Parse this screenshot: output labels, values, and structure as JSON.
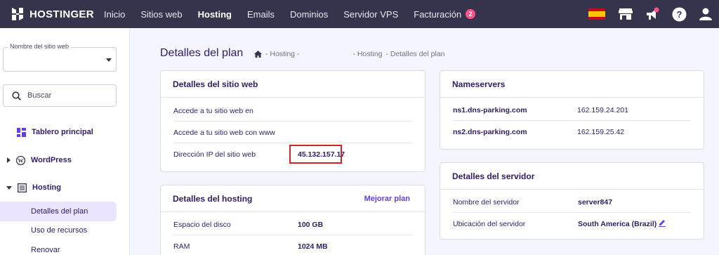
{
  "brand": {
    "name": "HOSTINGER",
    "accent": "#673de6",
    "topbar_bg": "#36344d",
    "badge_color": "#fc5185",
    "highlight": "#d3251f"
  },
  "nav": {
    "items": [
      {
        "label": "Inicio"
      },
      {
        "label": "Sitios web"
      },
      {
        "label": "Hosting",
        "active": true
      },
      {
        "label": "Emails"
      },
      {
        "label": "Dominios"
      },
      {
        "label": "Servidor VPS"
      },
      {
        "label": "Facturación",
        "badge": "2"
      }
    ]
  },
  "topbar_icons": [
    "spain-flag-icon",
    "store-icon",
    "megaphone-icon",
    "help-icon",
    "account-icon"
  ],
  "sidebar": {
    "site_select_label": "Nombre del sitio web",
    "site_select_value": "",
    "search_placeholder": "Buscar",
    "items": [
      {
        "label": "Tablero principal",
        "icon": "dashboard-icon"
      },
      {
        "label": "WordPress",
        "icon": "wordpress-icon"
      },
      {
        "label": "Hosting",
        "icon": "hosting-icon"
      }
    ],
    "sub_items": [
      {
        "label": "Detalles del plan",
        "active": true
      },
      {
        "label": "Uso de recursos"
      },
      {
        "label": "Renovar"
      }
    ]
  },
  "page": {
    "title": "Detalles del plan",
    "breadcrumb": [
      "- Hosting -",
      "- Hosting",
      "- Detalles del plan"
    ]
  },
  "website_details": {
    "title": "Detalles del sitio web",
    "rows": [
      {
        "label": "Accede a tu sitio web en",
        "value": ""
      },
      {
        "label": "Accede a tu sitio web con www",
        "value": ""
      },
      {
        "label": "Dirección IP del sitio web",
        "value": "45.132.157.17"
      }
    ]
  },
  "hosting_details": {
    "title": "Detalles del hosting",
    "action": "Mejorar plan",
    "rows": [
      {
        "label": "Espacio del disco",
        "value": "100 GB"
      },
      {
        "label": "RAM",
        "value": "1024 MB"
      }
    ]
  },
  "nameservers": {
    "title": "Nameservers",
    "rows": [
      {
        "label": "ns1.dns-parking.com",
        "value": "162.159.24.201"
      },
      {
        "label": "ns2.dns-parking.com",
        "value": "162.159.25.42"
      }
    ]
  },
  "server_details": {
    "title": "Detalles del servidor",
    "rows": [
      {
        "label": "Nombre del servidor",
        "value": "server847"
      },
      {
        "label": "Ubicación del servidor",
        "value": "South America (Brazil)"
      }
    ]
  }
}
